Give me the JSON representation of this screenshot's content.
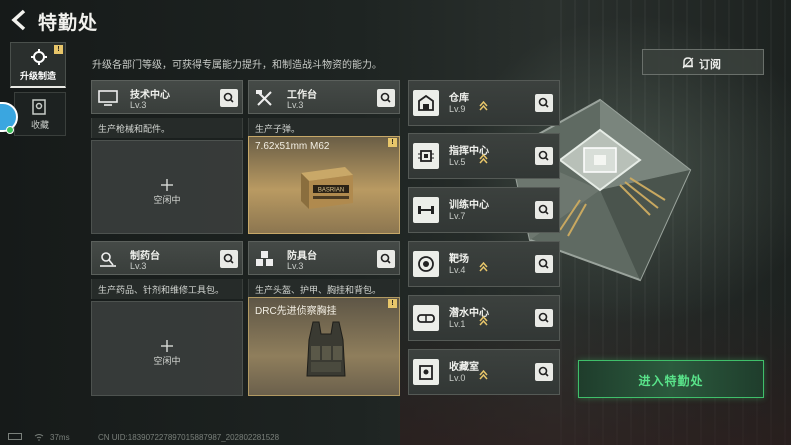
{
  "header": {
    "title": "特勤处"
  },
  "subtitle": "升级各部门等级，可获得专属能力提升，和制造战斗物资的能力。",
  "side_tabs": {
    "upgrade": {
      "label": "升级制造",
      "badge": "!"
    },
    "collection": {
      "label": "收藏"
    }
  },
  "facilities": [
    {
      "name": "技术中心",
      "level": "Lv.3",
      "desc": "生产枪械和配件。",
      "slot_state": "空闲中"
    },
    {
      "name": "工作台",
      "level": "Lv.3",
      "desc": "生产子弹。",
      "item": "7.62x51mm M62",
      "alert": "!"
    },
    {
      "name": "制药台",
      "level": "Lv.3",
      "desc": "生产药品、针剂和维修工具包。",
      "slot_state": "空闲中"
    },
    {
      "name": "防具台",
      "level": "Lv.3",
      "desc": "生产头盔、护甲、胸挂和背包。",
      "item": "DRC先进侦察胸挂",
      "alert": "!"
    }
  ],
  "box_label": "BASRIAN",
  "rooms": [
    {
      "name": "仓库",
      "level": "Lv.9",
      "icon": "warehouse-icon"
    },
    {
      "name": "指挥中心",
      "level": "Lv.5",
      "icon": "chip-icon"
    },
    {
      "name": "训练中心",
      "level": "Lv.7",
      "icon": "dumbbell-icon"
    },
    {
      "name": "靶场",
      "level": "Lv.4",
      "icon": "target-icon"
    },
    {
      "name": "潜水中心",
      "level": "Lv.1",
      "icon": "diving-mask-icon"
    },
    {
      "name": "收藏室",
      "level": "Lv.0",
      "icon": "collection-icon"
    }
  ],
  "buttons": {
    "subscribe": "订阅",
    "enter": "进入特勤处"
  },
  "status": {
    "ping": "37ms",
    "uid": "CN UID:18390722789701588798​7_202802281528"
  },
  "colors": {
    "accent_green": "#59e38a",
    "upgrade_gold": "#e8c66a",
    "panel": "#3c413e"
  }
}
